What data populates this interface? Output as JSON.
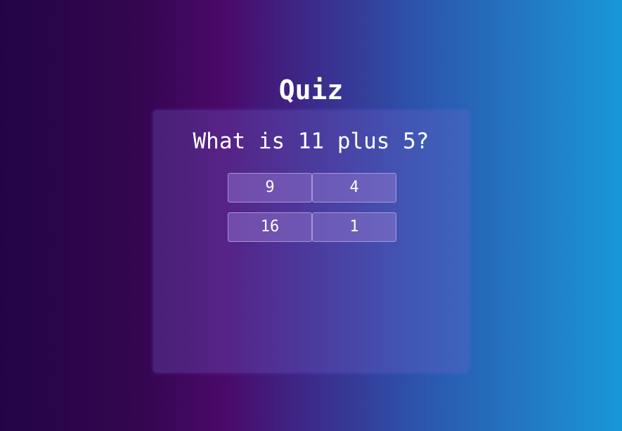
{
  "page": {
    "title": "Quiz"
  },
  "quiz": {
    "question": "What is 11 plus 5?",
    "answers": [
      "9",
      "4",
      "16",
      "1"
    ]
  }
}
